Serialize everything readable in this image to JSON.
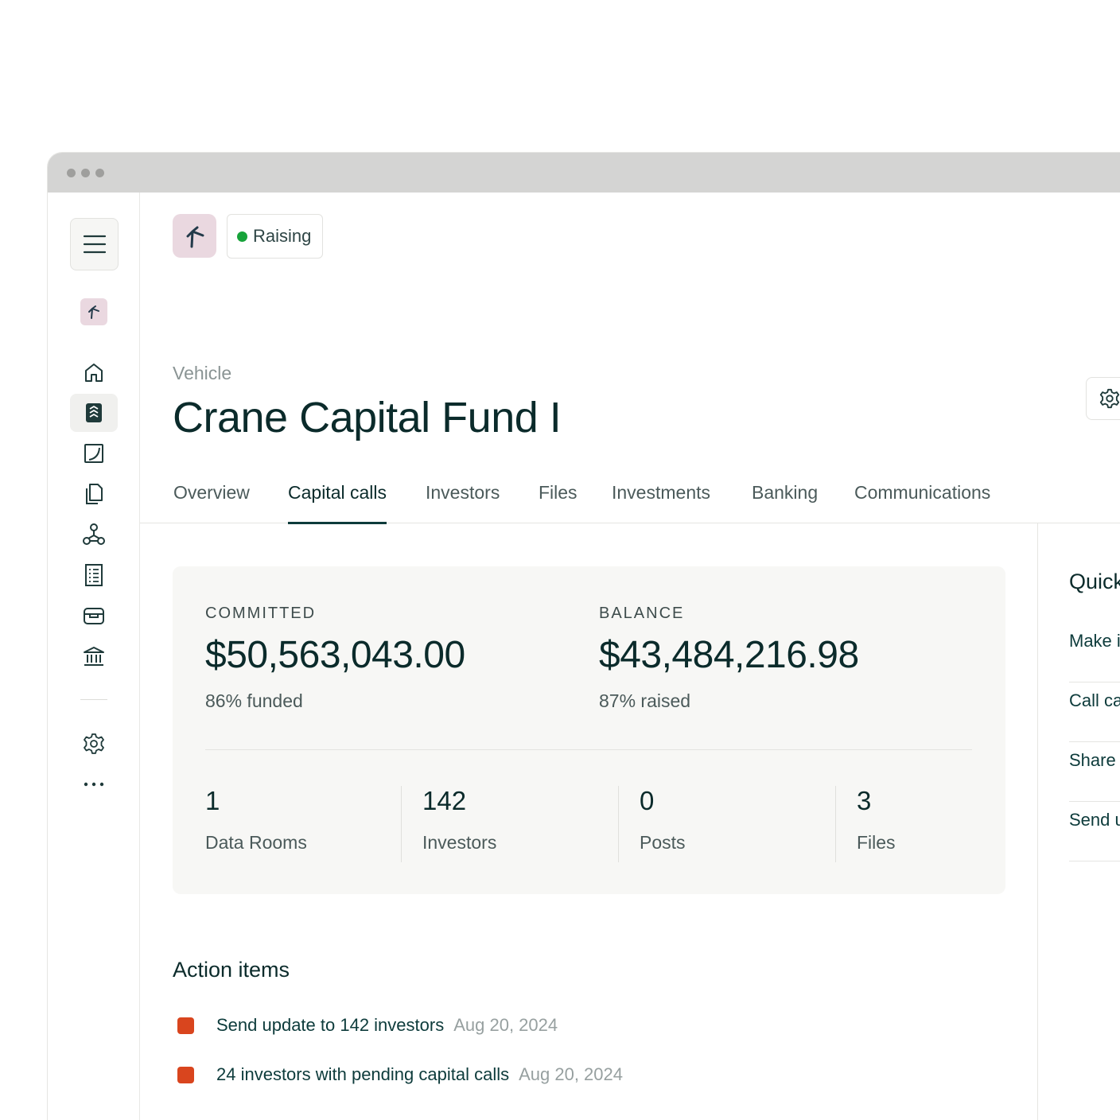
{
  "window": {
    "controls": [
      "close",
      "minimize",
      "maximize"
    ]
  },
  "sidebar": {
    "items": [
      {
        "name": "home",
        "icon": "home-icon",
        "active": false
      },
      {
        "name": "capital-calls",
        "icon": "ledger-icon",
        "active": true
      },
      {
        "name": "notes",
        "icon": "document-corner-icon",
        "active": false
      },
      {
        "name": "files",
        "icon": "files-icon",
        "active": false
      },
      {
        "name": "network",
        "icon": "network-icon",
        "active": false
      },
      {
        "name": "reports",
        "icon": "receipt-icon",
        "active": false
      },
      {
        "name": "wallet",
        "icon": "wallet-icon",
        "active": false
      },
      {
        "name": "banking",
        "icon": "bank-icon",
        "active": false
      }
    ],
    "bottom": [
      {
        "name": "settings",
        "icon": "gear-icon"
      },
      {
        "name": "more",
        "icon": "more-icon"
      }
    ]
  },
  "header": {
    "status": "Raising",
    "status_color": "#17a33a",
    "vehicle_label": "Vehicle",
    "fund_name": "Crane Capital Fund I"
  },
  "tabs": [
    {
      "label": "Overview",
      "active": false
    },
    {
      "label": "Capital calls",
      "active": true
    },
    {
      "label": "Investors",
      "active": false
    },
    {
      "label": "Files",
      "active": false
    },
    {
      "label": "Investments",
      "active": false
    },
    {
      "label": "Banking",
      "active": false
    },
    {
      "label": "Communications",
      "active": false
    }
  ],
  "stats": {
    "committed": {
      "label": "COMMITTED",
      "value": "$50,563,043.00",
      "sub": "86% funded"
    },
    "balance": {
      "label": "BALANCE",
      "value": "$43,484,216.98",
      "sub": "87% raised"
    },
    "counts": [
      {
        "num": "1",
        "label": "Data Rooms"
      },
      {
        "num": "142",
        "label": "Investors"
      },
      {
        "num": "0",
        "label": "Posts"
      },
      {
        "num": "3",
        "label": "Files"
      }
    ]
  },
  "actions": {
    "title": "Action items",
    "accent": "#d9451e",
    "items": [
      {
        "text": "Send update to 142 investors",
        "date": "Aug 20, 2024"
      },
      {
        "text": "24 investors with pending capital calls",
        "date": "Aug 20, 2024"
      }
    ]
  },
  "quick": {
    "title": "Quick",
    "links": [
      "Make i",
      "Call ca",
      "Share",
      "Send u"
    ]
  }
}
